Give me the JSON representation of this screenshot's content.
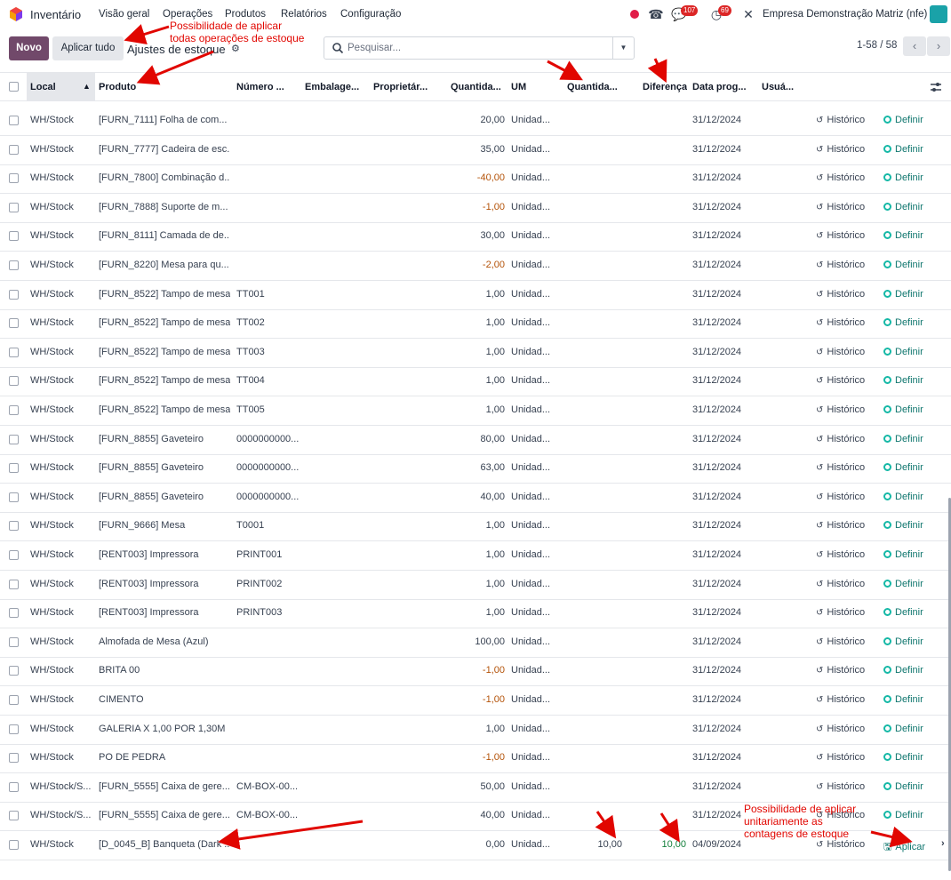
{
  "nav": {
    "app_name": "Inventário",
    "menu": [
      "Visão geral",
      "Operações",
      "Produtos",
      "Relatórios",
      "Configuração"
    ],
    "messages_badge": "107",
    "activities_badge": "69",
    "company": "Empresa Demonstração Matriz (nfe)"
  },
  "control": {
    "new_label": "Novo",
    "apply_all_label": "Aplicar tudo",
    "breadcrumb": "Ajustes de estoque",
    "search_placeholder": "Pesquisar...",
    "pager": "1-58 / 58"
  },
  "table": {
    "headers": [
      "Local",
      "Produto",
      "Número ...",
      "Embalage...",
      "Proprietár...",
      "Quantida...",
      "UM",
      "Quantida...",
      "Diferença",
      "Data prog...",
      "Usuá..."
    ],
    "history_label": "Histórico",
    "set_label": "Definir",
    "apply_label": "Aplicar",
    "rows": [
      {
        "local": "WH/Stock",
        "produto": "[FURN_7111] Folha de com...",
        "lote": "",
        "qty": "20,00",
        "um": "Unidad...",
        "counted": "",
        "diff": "",
        "date": "31/12/2024",
        "neg": false,
        "action": "set"
      },
      {
        "local": "WH/Stock",
        "produto": "[FURN_7777] Cadeira de esc...",
        "lote": "",
        "qty": "35,00",
        "um": "Unidad...",
        "counted": "",
        "diff": "",
        "date": "31/12/2024",
        "neg": false,
        "action": "set"
      },
      {
        "local": "WH/Stock",
        "produto": "[FURN_7800] Combinação d...",
        "lote": "",
        "qty": "-40,00",
        "um": "Unidad...",
        "counted": "",
        "diff": "",
        "date": "31/12/2024",
        "neg": true,
        "action": "set"
      },
      {
        "local": "WH/Stock",
        "produto": "[FURN_7888] Suporte de m...",
        "lote": "",
        "qty": "-1,00",
        "um": "Unidad...",
        "counted": "",
        "diff": "",
        "date": "31/12/2024",
        "neg": true,
        "action": "set"
      },
      {
        "local": "WH/Stock",
        "produto": "[FURN_8111] Camada de de...",
        "lote": "",
        "qty": "30,00",
        "um": "Unidad...",
        "counted": "",
        "diff": "",
        "date": "31/12/2024",
        "neg": false,
        "action": "set"
      },
      {
        "local": "WH/Stock",
        "produto": "[FURN_8220] Mesa para qu...",
        "lote": "",
        "qty": "-2,00",
        "um": "Unidad...",
        "counted": "",
        "diff": "",
        "date": "31/12/2024",
        "neg": true,
        "action": "set"
      },
      {
        "local": "WH/Stock",
        "produto": "[FURN_8522] Tampo de mesa",
        "lote": "TT001",
        "qty": "1,00",
        "um": "Unidad...",
        "counted": "",
        "diff": "",
        "date": "31/12/2024",
        "neg": false,
        "action": "set"
      },
      {
        "local": "WH/Stock",
        "produto": "[FURN_8522] Tampo de mesa",
        "lote": "TT002",
        "qty": "1,00",
        "um": "Unidad...",
        "counted": "",
        "diff": "",
        "date": "31/12/2024",
        "neg": false,
        "action": "set"
      },
      {
        "local": "WH/Stock",
        "produto": "[FURN_8522] Tampo de mesa",
        "lote": "TT003",
        "qty": "1,00",
        "um": "Unidad...",
        "counted": "",
        "diff": "",
        "date": "31/12/2024",
        "neg": false,
        "action": "set"
      },
      {
        "local": "WH/Stock",
        "produto": "[FURN_8522] Tampo de mesa",
        "lote": "TT004",
        "qty": "1,00",
        "um": "Unidad...",
        "counted": "",
        "diff": "",
        "date": "31/12/2024",
        "neg": false,
        "action": "set"
      },
      {
        "local": "WH/Stock",
        "produto": "[FURN_8522] Tampo de mesa",
        "lote": "TT005",
        "qty": "1,00",
        "um": "Unidad...",
        "counted": "",
        "diff": "",
        "date": "31/12/2024",
        "neg": false,
        "action": "set"
      },
      {
        "local": "WH/Stock",
        "produto": "[FURN_8855] Gaveteiro",
        "lote": "0000000000...",
        "qty": "80,00",
        "um": "Unidad...",
        "counted": "",
        "diff": "",
        "date": "31/12/2024",
        "neg": false,
        "action": "set"
      },
      {
        "local": "WH/Stock",
        "produto": "[FURN_8855] Gaveteiro",
        "lote": "0000000000...",
        "qty": "63,00",
        "um": "Unidad...",
        "counted": "",
        "diff": "",
        "date": "31/12/2024",
        "neg": false,
        "action": "set"
      },
      {
        "local": "WH/Stock",
        "produto": "[FURN_8855] Gaveteiro",
        "lote": "0000000000...",
        "qty": "40,00",
        "um": "Unidad...",
        "counted": "",
        "diff": "",
        "date": "31/12/2024",
        "neg": false,
        "action": "set"
      },
      {
        "local": "WH/Stock",
        "produto": "[FURN_9666] Mesa",
        "lote": "T0001",
        "qty": "1,00",
        "um": "Unidad...",
        "counted": "",
        "diff": "",
        "date": "31/12/2024",
        "neg": false,
        "action": "set"
      },
      {
        "local": "WH/Stock",
        "produto": "[RENT003] Impressora",
        "lote": "PRINT001",
        "qty": "1,00",
        "um": "Unidad...",
        "counted": "",
        "diff": "",
        "date": "31/12/2024",
        "neg": false,
        "action": "set"
      },
      {
        "local": "WH/Stock",
        "produto": "[RENT003] Impressora",
        "lote": "PRINT002",
        "qty": "1,00",
        "um": "Unidad...",
        "counted": "",
        "diff": "",
        "date": "31/12/2024",
        "neg": false,
        "action": "set"
      },
      {
        "local": "WH/Stock",
        "produto": "[RENT003] Impressora",
        "lote": "PRINT003",
        "qty": "1,00",
        "um": "Unidad...",
        "counted": "",
        "diff": "",
        "date": "31/12/2024",
        "neg": false,
        "action": "set"
      },
      {
        "local": "WH/Stock",
        "produto": "Almofada de Mesa (Azul)",
        "lote": "",
        "qty": "100,00",
        "um": "Unidad...",
        "counted": "",
        "diff": "",
        "date": "31/12/2024",
        "neg": false,
        "action": "set"
      },
      {
        "local": "WH/Stock",
        "produto": "BRITA 00",
        "lote": "",
        "qty": "-1,00",
        "um": "Unidad...",
        "counted": "",
        "diff": "",
        "date": "31/12/2024",
        "neg": true,
        "action": "set"
      },
      {
        "local": "WH/Stock",
        "produto": "CIMENTO",
        "lote": "",
        "qty": "-1,00",
        "um": "Unidad...",
        "counted": "",
        "diff": "",
        "date": "31/12/2024",
        "neg": true,
        "action": "set"
      },
      {
        "local": "WH/Stock",
        "produto": "GALERIA X 1,00 POR 1,30M",
        "lote": "",
        "qty": "1,00",
        "um": "Unidad...",
        "counted": "",
        "diff": "",
        "date": "31/12/2024",
        "neg": false,
        "action": "set"
      },
      {
        "local": "WH/Stock",
        "produto": "PO DE PEDRA",
        "lote": "",
        "qty": "-1,00",
        "um": "Unidad...",
        "counted": "",
        "diff": "",
        "date": "31/12/2024",
        "neg": true,
        "action": "set"
      },
      {
        "local": "WH/Stock/S...",
        "produto": "[FURN_5555] Caixa de gere...",
        "lote": "CM-BOX-00...",
        "qty": "50,00",
        "um": "Unidad...",
        "counted": "",
        "diff": "",
        "date": "31/12/2024",
        "neg": false,
        "action": "set"
      },
      {
        "local": "WH/Stock/S...",
        "produto": "[FURN_5555] Caixa de gere...",
        "lote": "CM-BOX-00...",
        "qty": "40,00",
        "um": "Unidad...",
        "counted": "",
        "diff": "",
        "date": "31/12/2024",
        "neg": false,
        "action": "set"
      },
      {
        "local": "WH/Stock",
        "produto": "[D_0045_B] Banqueta (Dark ...",
        "lote": "",
        "qty": "0,00",
        "um": "Unidad...",
        "counted": "10,00",
        "diff": "10,00",
        "date": "04/09/2024",
        "neg": false,
        "action": "apply"
      }
    ]
  },
  "annotations": {
    "top": [
      "Possibilidade de aplicar",
      "todas operações de estoque"
    ],
    "bottom": [
      "Possibilidade de aplicar",
      "unitariamente as",
      "contagens de estoque"
    ]
  },
  "colors": {
    "primary": "#71496a",
    "annotation": "#e10600",
    "negative": "#b45309",
    "positive": "#15803d",
    "teal": "#0f766e"
  }
}
